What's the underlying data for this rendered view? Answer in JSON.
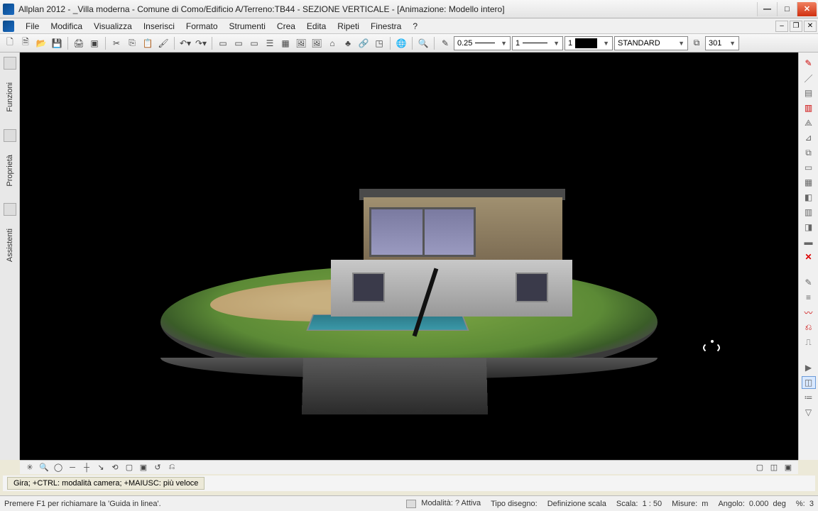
{
  "title_bar": {
    "text": "Allplan 2012 - _Villa moderna - Comune di Como/Edificio A/Terreno:TB44 - SEZIONE VERTICALE - [Animazione: Modello intero]"
  },
  "menu": {
    "items": [
      "File",
      "Modifica",
      "Visualizza",
      "Inserisci",
      "Formato",
      "Strumenti",
      "Crea",
      "Edita",
      "Ripeti",
      "Finestra",
      "?"
    ]
  },
  "toolbar": {
    "line_weight": "0.25",
    "line_type": "1",
    "pen": "1",
    "color_swatch": "#000000",
    "layer": "STANDARD",
    "layer_id": "301"
  },
  "left_tabs": {
    "tab1": "Funzioni",
    "tab2": "Proprietà",
    "tab3": "Assistenti"
  },
  "viewport_bottom_icons": [
    "✳",
    "🔍",
    "◯",
    "┼",
    "⊕",
    "↘",
    "⟲",
    "▢",
    "▣",
    "↺",
    "⎌"
  ],
  "hint": {
    "text": "Gira;  +CTRL: modalità camera; +MAIUSC: più veloce"
  },
  "status": {
    "f1_hint": "Premere F1 per richiamare la 'Guida in linea'.",
    "mode_label": "Modalità:",
    "mode_value": "? Attiva",
    "drawing_type_label": "Tipo disegno:",
    "scale_def": "Definizione scala",
    "scale_label": "Scala:",
    "scale_value": "1 : 50",
    "units_label": "Misure:",
    "units_value": "m",
    "angle_label": "Angolo:",
    "angle_value": "0.000",
    "angle_unit": "deg",
    "pct_label": "%:",
    "pct_value": "3"
  },
  "right_palette_icons": [
    "✎",
    "↯",
    "≣",
    "▤",
    "⟁",
    "⊿",
    "⧉",
    "▭",
    "▦",
    "◧",
    "▥",
    "◨",
    "▬",
    "✕",
    "—",
    "✎",
    "≡",
    "〰",
    "⎌",
    "⎍",
    "—",
    "▼",
    "◫",
    "≔",
    "▽"
  ]
}
